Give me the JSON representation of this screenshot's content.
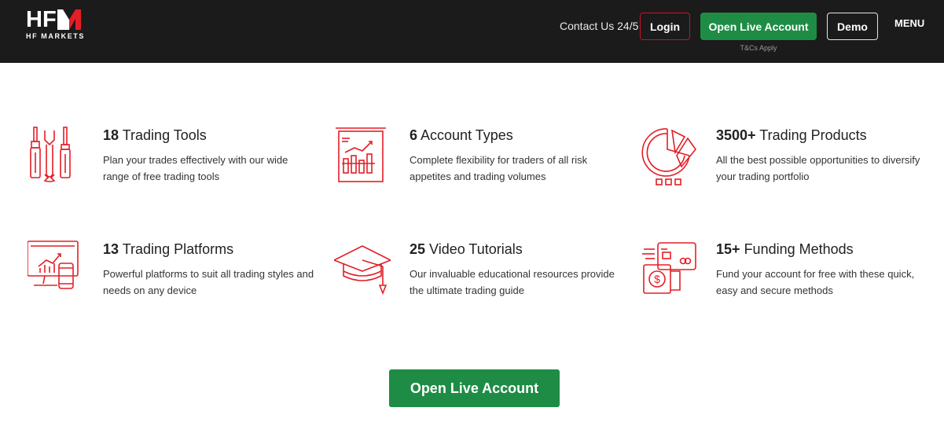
{
  "brand": {
    "logo_text": "HFM",
    "logo_sub": "HF MARKETS",
    "accent": "#e41e26",
    "green": "#1e8c45"
  },
  "header": {
    "contact": "Contact Us 24/5",
    "login": "Login",
    "open_live": "Open Live Account",
    "tcs": "T&Cs Apply",
    "demo": "Demo",
    "menu": "MENU"
  },
  "features": [
    {
      "num": "18",
      "title": "Trading Tools",
      "desc": "Plan your trades effectively with our wide range of free trading tools",
      "icon": "tools-icon"
    },
    {
      "num": "6",
      "title": "Account Types",
      "desc": "Complete flexibility for traders of all risk appetites and trading volumes",
      "icon": "chart-board-icon"
    },
    {
      "num": "3500+",
      "title": "Trading Products",
      "desc": "All the best possible opportunities to diversify your trading portfolio",
      "icon": "pie-chart-icon"
    },
    {
      "num": "13",
      "title": "Trading Platforms",
      "desc": "Powerful platforms to suit all trading styles and needs on any device",
      "icon": "devices-icon"
    },
    {
      "num": "25",
      "title": "Video Tutorials",
      "desc": "Our invaluable educational resources provide the ultimate trading guide",
      "icon": "graduation-cap-icon"
    },
    {
      "num": "15+",
      "title": "Funding Methods",
      "desc": "Fund your account for free with these quick, easy and secure methods",
      "icon": "payment-card-icon"
    }
  ],
  "cta": {
    "label": "Open Live Account"
  }
}
